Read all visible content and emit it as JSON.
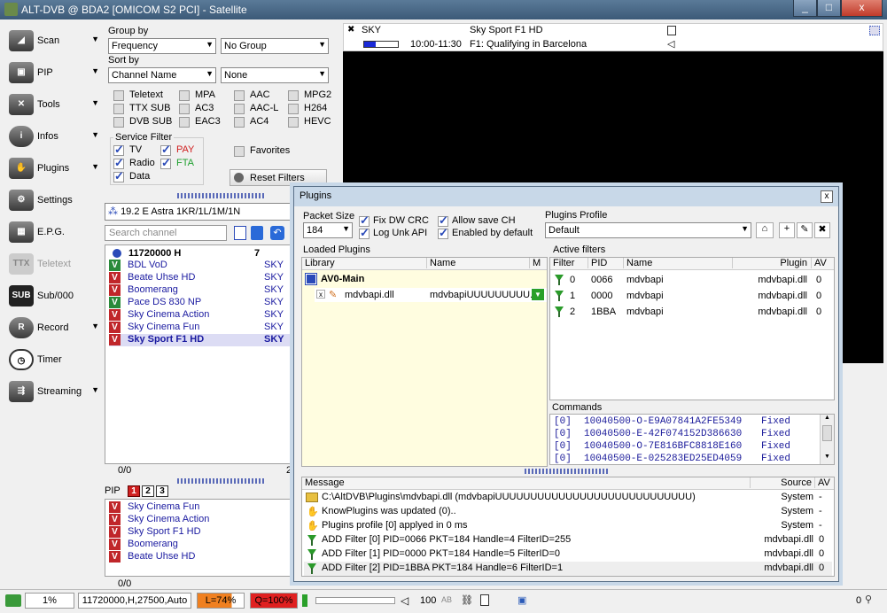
{
  "window": {
    "title": "ALT-DVB @ BDA2 [OMICOM S2 PCI] - Satellite",
    "minimize": "_",
    "maximize": "□",
    "close": "x"
  },
  "nav": {
    "items": [
      {
        "label": "Scan",
        "icon": "satellite-dish-icon"
      },
      {
        "label": "PIP",
        "icon": "pip-icon"
      },
      {
        "label": "Tools",
        "icon": "tools-icon"
      },
      {
        "label": "Infos",
        "icon": "info-icon"
      },
      {
        "label": "Plugins",
        "icon": "plugin-icon"
      },
      {
        "label": "Settings",
        "icon": "gear-icon"
      },
      {
        "label": "E.P.G.",
        "icon": "epg-icon"
      },
      {
        "label": "Teletext",
        "icon": "teletext-icon"
      },
      {
        "label": "Sub/000",
        "icon": "subtitle-icon"
      },
      {
        "label": "Record",
        "icon": "record-icon"
      },
      {
        "label": "Timer",
        "icon": "timer-icon"
      },
      {
        "label": "Streaming",
        "icon": "streaming-icon"
      }
    ]
  },
  "channels": {
    "group_by_label": "Group by",
    "group_by_value": "Frequency",
    "group_by_value2": "No Group",
    "sort_by_label": "Sort by",
    "sort_by_value": "Channel Name",
    "sort_by_value2": "None",
    "stream_filters": [
      "Teletext",
      "MPA",
      "AAC",
      "MPG2",
      "TTX SUB",
      "AC3",
      "AAC-L",
      "H264",
      "DVB SUB",
      "EAC3",
      "AC4",
      "HEVC"
    ],
    "service_filter_label": "Service Filter",
    "service_filters": [
      {
        "label": "TV",
        "color": "#000000"
      },
      {
        "label": "PAY",
        "color": "#d02020"
      },
      {
        "label": "Radio",
        "color": "#000000"
      },
      {
        "label": "FTA",
        "color": "#20a030"
      },
      {
        "label": "Data",
        "color": "#000000"
      }
    ],
    "favorites_label": "Favorites",
    "reset_filters_label": "Reset Filters",
    "satellite": "19.2 E Astra 1KR/1L/1M/1N",
    "search_placeholder": "Search channel",
    "transponder": "11720000 H",
    "transponder_count": "7",
    "list": [
      {
        "name": "BDL VoD",
        "provider": "SKY",
        "type": "fta"
      },
      {
        "name": "Beate Uhse HD",
        "provider": "SKY",
        "type": "pay"
      },
      {
        "name": "Boomerang",
        "provider": "SKY",
        "type": "pay"
      },
      {
        "name": "Pace DS 830 NP",
        "provider": "SKY",
        "type": "fta"
      },
      {
        "name": "Sky Cinema Action",
        "provider": "SKY",
        "type": "pay"
      },
      {
        "name": "Sky Cinema Fun",
        "provider": "SKY",
        "type": "pay"
      },
      {
        "name": "Sky Sport F1 HD",
        "provider": "SKY",
        "type": "pay",
        "selected": true
      }
    ],
    "footer_count": "0/0",
    "footer_right": "2"
  },
  "pip": {
    "label": "PIP",
    "tabs": [
      "1",
      "2",
      "3"
    ],
    "list": [
      "Sky Cinema Fun",
      "Sky Cinema Action",
      "Sky Sport F1 HD",
      "Boomerang",
      "Beate Uhse HD"
    ],
    "footer_count": "0/0"
  },
  "epg": {
    "provider": "SKY",
    "channel": "Sky Sport F1 HD",
    "time": "10:00-11:30",
    "program": "F1: Qualifying in Barcelona",
    "progress": 0.35
  },
  "plugins": {
    "title": "Plugins",
    "close": "x",
    "packet_size_label": "Packet Size",
    "packet_size_value": "184",
    "options": [
      "Fix DW CRC",
      "Allow save CH",
      "Log Unk API",
      "Enabled by default"
    ],
    "profile_label": "Plugins Profile",
    "profile_value": "Default",
    "loaded_label": "Loaded Plugins",
    "loaded_headers": {
      "library": "Library",
      "name": "Name",
      "m": "M"
    },
    "main_group": "AV0-Main",
    "loaded": [
      {
        "library": "mdvbapi.dll",
        "name": "mdvbapiUUUUUUUUU..."
      }
    ],
    "active_label": "Active filters",
    "active_headers": {
      "filter": "Filter",
      "pid": "PID",
      "name": "Name",
      "plugin": "Plugin",
      "av": "AV"
    },
    "active": [
      {
        "filter": "0",
        "pid": "0066",
        "name": "mdvbapi",
        "plugin": "mdvbapi.dll",
        "av": "0"
      },
      {
        "filter": "1",
        "pid": "0000",
        "name": "mdvbapi",
        "plugin": "mdvbapi.dll",
        "av": "0"
      },
      {
        "filter": "2",
        "pid": "1BBA",
        "name": "mdvbapi",
        "plugin": "mdvbapi.dll",
        "av": "0"
      }
    ],
    "commands_label": "Commands",
    "commands": [
      {
        "idx": "[0]",
        "code": "10040500-O-E9A07841A2FE5349",
        "status": "Fixed"
      },
      {
        "idx": "[0]",
        "code": "10040500-E-42F074152D386630",
        "status": "Fixed"
      },
      {
        "idx": "[0]",
        "code": "10040500-O-7E816BFC8818E160",
        "status": "Fixed"
      },
      {
        "idx": "[0]",
        "code": "10040500-E-025283ED25ED4059",
        "status": "Fixed"
      }
    ],
    "message_headers": {
      "message": "Message",
      "source": "Source",
      "av": "AV"
    },
    "messages": [
      {
        "text": "C:\\AltDVB\\Plugins\\mdvbapi.dll (mdvbapiUUUUUUUUUUUUUUUUUUUUUUUUUUUU)",
        "source": "System",
        "av": "-",
        "icon": "folder-icon"
      },
      {
        "text": "KnowPlugins was updated (0)..",
        "source": "System",
        "av": "-",
        "icon": "plugin-icon"
      },
      {
        "text": "Plugins profile [0] applyed in 0 ms",
        "source": "System",
        "av": "-",
        "icon": "plugin-icon"
      },
      {
        "text": "ADD Filter [0] PID=0066 PKT=184 Handle=4 FilterID=255",
        "source": "mdvbapi.dll",
        "av": "0",
        "icon": "filter-icon"
      },
      {
        "text": "ADD Filter [1] PID=0000 PKT=184 Handle=5 FilterID=0",
        "source": "mdvbapi.dll",
        "av": "0",
        "icon": "filter-icon"
      },
      {
        "text": "ADD Filter [2] PID=1BBA PKT=184 Handle=6 FilterID=1",
        "source": "mdvbapi.dll",
        "av": "0",
        "icon": "filter-icon"
      }
    ]
  },
  "status": {
    "percent": "1%",
    "tuning": "11720000,H,27500,Auto",
    "level": "L=74%",
    "quality": "Q=100%",
    "volume": "100",
    "ab": "AB",
    "right_value": "0",
    "level_color": "#f08020",
    "quality_color": "#e02020"
  }
}
